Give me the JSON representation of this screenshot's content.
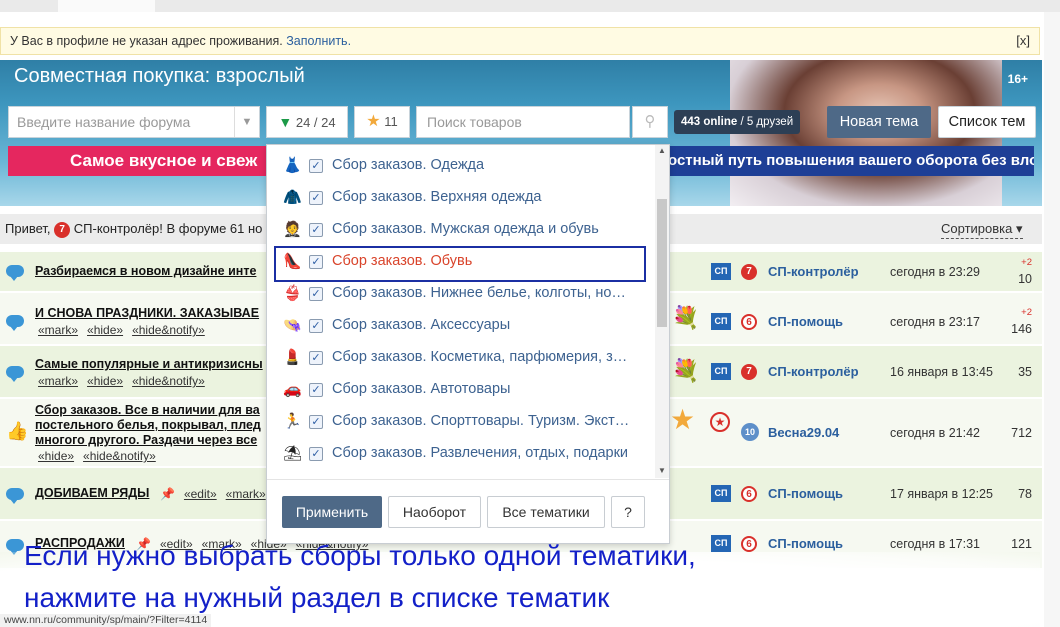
{
  "notice": {
    "text": "У Вас в профиле не указан адрес проживания.",
    "link": "Заполнить.",
    "close": "[x]"
  },
  "header": {
    "title": "Совместная покупка: взрослый",
    "age": "16+",
    "forum_placeholder": "Введите название форума",
    "filter_count": "24 / 24",
    "fav_count": "11",
    "search_placeholder": "Поиск товаров",
    "online_count": "443 online",
    "friends": " / 5 друзей",
    "new_topic": "Новая тема",
    "topic_list": "Список тем",
    "banner_left": "Самое вкусное и свеж",
    "banner_right": "остный путь повышения вашего оборота без вложений!"
  },
  "greeting": {
    "prefix": "Привет,",
    "user": "СП-контролёр! В форуме 61 но",
    "sort": "Сортировка ▾"
  },
  "rows": [
    {
      "title": "Разбираемся в новом дизайне инте",
      "tags": [],
      "user": "СП-контролёр",
      "badge": "7",
      "date": "сегодня в 23:29",
      "plus": "+2",
      "count": "10"
    },
    {
      "title": "И СНОВА ПРАЗДНИКИ. ЗАКАЗЫВАЕ",
      "tags": [
        "«mark»",
        "«hide»",
        "«hide&notify»"
      ],
      "user": "СП-помощь",
      "badge": "6",
      "date": "сегодня в 23:17",
      "plus": "+2",
      "count": "146"
    },
    {
      "title": "Самые популярные и антикризисны",
      "tags": [
        "«mark»",
        "«hide»",
        "«hide&notify»"
      ],
      "user": "СП-контролёр",
      "badge": "7",
      "date": "16 января в 13:45",
      "plus": "",
      "count": "35"
    },
    {
      "title": "Сбор заказов. Все в наличии для ва",
      "title2": "постельного белья, покрывал, плед",
      "title3": "многого другого. Раздачи через все",
      "tags": [
        "«hide»",
        "«hide&notify»"
      ],
      "user": "Весна29.04",
      "badge": "10",
      "date": "сегодня в 21:42",
      "plus": "",
      "count": "712"
    },
    {
      "title": "ДОБИВАЕМ РЯДЫ",
      "tags_inline": [
        "«edit»",
        "«mark»"
      ],
      "user": "СП-помощь",
      "badge": "6",
      "date": "17 января в 12:25",
      "plus": "",
      "count": "78"
    },
    {
      "title": "РАСПРОДАЖИ",
      "tags_inline": [
        "«edit»",
        "«mark»",
        "«hide»",
        "«hide&notify»"
      ],
      "user": "СП-помощь",
      "badge": "6",
      "date": "сегодня в 17:31",
      "plus": "",
      "count": "121"
    }
  ],
  "dropdown": {
    "items": [
      {
        "label": "Сбор заказов. Одежда",
        "icon": "dress-icon",
        "glyph": "👗"
      },
      {
        "label": "Сбор заказов. Верхняя одежда",
        "icon": "coat-icon",
        "glyph": "🧥"
      },
      {
        "label": "Сбор заказов. Мужская одежда и обувь",
        "icon": "suit-icon",
        "glyph": "🤵"
      },
      {
        "label": "Сбор заказов. Обувь",
        "icon": "shoe-icon",
        "glyph": "👠"
      },
      {
        "label": "Сбор заказов. Нижнее белье, колготы, но…",
        "icon": "lingerie-icon",
        "glyph": "👙"
      },
      {
        "label": "Сбор заказов. Аксессуары",
        "icon": "hat-icon",
        "glyph": "👒"
      },
      {
        "label": "Сбор заказов. Косметика, парфюмерия, з…",
        "icon": "cosmetics-icon",
        "glyph": "💄"
      },
      {
        "label": "Сбор заказов. Автотовары",
        "icon": "car-icon",
        "glyph": "🚗"
      },
      {
        "label": "Сбор заказов. Спорттовары. Туризм. Экст…",
        "icon": "sport-icon",
        "glyph": "🏃"
      },
      {
        "label": "Сбор заказов. Развлечения, отдых, подарки",
        "icon": "umbrella-icon",
        "glyph": "⛱"
      }
    ],
    "apply": "Применить",
    "invert": "Наоборот",
    "all": "Все тематики",
    "help": "?"
  },
  "annotation": {
    "line1": "Если нужно выбрать сборы только одной тематики,",
    "line2": "нажмите на нужный раздел в списке тематик"
  },
  "status_url": "www.nn.ru/community/sp/main/?Filter=4114"
}
